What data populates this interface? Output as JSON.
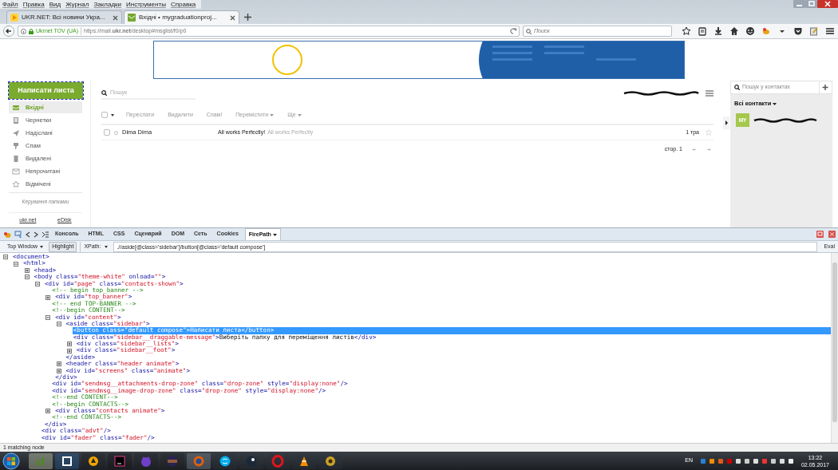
{
  "browser": {
    "menu": [
      "Файл",
      "Правка",
      "Вид",
      "Журнал",
      "Закладки",
      "Инструменты",
      "Справка"
    ],
    "tabs": [
      {
        "label": "UKR.NET: Всі новини Укра...",
        "selected": false
      },
      {
        "label": "Вхідні • mygraduationproj...",
        "selected": true
      }
    ],
    "identity": "Ukrnet TOV (UA)",
    "url": "https://mail.**ukr.net**/desktop#msglist/f0/p0",
    "search": {
      "placeholder": "Поиск"
    }
  },
  "mail": {
    "compose": "Написати листа",
    "folders": [
      {
        "kind": "inbox",
        "label": "Вхідні",
        "selected": true
      },
      {
        "kind": "drafts",
        "label": "Чернетки",
        "selected": false
      },
      {
        "kind": "sent",
        "label": "Надіслані",
        "selected": false
      },
      {
        "kind": "spam",
        "label": "Спам",
        "selected": false
      },
      {
        "kind": "trash",
        "label": "Видалені",
        "selected": false
      },
      {
        "kind": "unread",
        "label": "Непрочитані",
        "selected": false
      },
      {
        "kind": "starred",
        "label": "Відмічені",
        "selected": false
      }
    ],
    "manage_folders": "Керування папками",
    "footer_links": [
      "ukr.net",
      "eDisk"
    ],
    "search": {
      "placeholder": "Пошук"
    },
    "actions": [
      {
        "label": "Переслати",
        "menu": false
      },
      {
        "label": "Видалити",
        "menu": false
      },
      {
        "label": "Спам!",
        "menu": false
      },
      {
        "label": "Перемістити",
        "menu": true
      },
      {
        "label": "Ще",
        "menu": true
      }
    ],
    "messages": [
      {
        "sender": "Dima Dima",
        "subject": "All works Perfectly!",
        "preview": "All works Perfectly",
        "date": "1 тра",
        "checked": false,
        "starred": false
      }
    ],
    "page": "стор. 1",
    "contacts": {
      "search": {
        "placeholder": "Пошук у контактах"
      },
      "filter": "Всі контакти",
      "items": [
        {
          "initials": "MY"
        }
      ]
    }
  },
  "devtools": {
    "tabs": [
      {
        "label": "Консоль",
        "selected": false,
        "menu": false
      },
      {
        "label": "HTML",
        "selected": false,
        "menu": false
      },
      {
        "label": "CSS",
        "selected": false,
        "menu": false
      },
      {
        "label": "Сценарий",
        "selected": false,
        "menu": false
      },
      {
        "label": "DOM",
        "selected": false,
        "menu": false
      },
      {
        "label": "Сеть",
        "selected": false,
        "menu": false
      },
      {
        "label": "Cookies",
        "selected": false,
        "menu": false
      },
      {
        "label": "FirePath",
        "selected": true,
        "menu": true
      }
    ],
    "frame": "Top Window",
    "highlight": "Highlight",
    "xpath_label": "XPath:",
    "xpath": ".//aside[@class='sidebar']/button[@class='default compose']",
    "eval": "Eval",
    "tree": [
      {
        "kind": "element",
        "text": "<document>",
        "expanded": true,
        "selected": false,
        "children": [
          {
            "kind": "element",
            "text": "<html>",
            "expanded": true,
            "selected": false,
            "children": [
              {
                "kind": "element",
                "text": "<head>",
                "expanded": false,
                "selected": false
              },
              {
                "kind": "element",
                "text": "<body class=\"theme-white\" onload=\"\">",
                "expanded": true,
                "selected": false,
                "children": [
                  {
                    "kind": "element",
                    "text": "<div id=\"page\" class=\"contacts-shown\">",
                    "expanded": true,
                    "selected": false,
                    "closing": "</div>",
                    "children": [
                      {
                        "kind": "comment",
                        "text": "<!-- begin top_banner -->",
                        "selected": false
                      },
                      {
                        "kind": "element",
                        "text": "<div id=\"top_banner\">",
                        "expanded": false,
                        "selected": false
                      },
                      {
                        "kind": "comment",
                        "text": "<!-- end TOP-BANNER -->",
                        "selected": false
                      },
                      {
                        "kind": "comment",
                        "text": "<!--begin CONTENT-->",
                        "selected": false
                      },
                      {
                        "kind": "element",
                        "text": "<div id=\"content\">",
                        "expanded": true,
                        "selected": false,
                        "closing": "</div>",
                        "children": [
                          {
                            "kind": "element",
                            "text": "<aside class=\"sidebar\">",
                            "expanded": true,
                            "selected": false,
                            "closing": "</aside>",
                            "children": [
                              {
                                "kind": "element",
                                "text": "<button class=\"default compose\">Написати листа</button>",
                                "selected": true
                              },
                              {
                                "kind": "element",
                                "text": "<div class=\"sidebar__draggable-message\">Виберіть папку для переміщення листів</div>",
                                "selected": false
                              },
                              {
                                "kind": "element",
                                "text": "<div class=\"sidebar__lists\">",
                                "expanded": false,
                                "selected": false
                              },
                              {
                                "kind": "element",
                                "text": "<div class=\"sidebar__foot\">",
                                "expanded": false,
                                "selected": false
                              }
                            ]
                          },
                          {
                            "kind": "element",
                            "text": "<header class=\"header animate\">",
                            "expanded": false,
                            "selected": false
                          },
                          {
                            "kind": "element",
                            "text": "<div id=\"screens\" class=\"animate\">",
                            "expanded": false,
                            "selected": false
                          }
                        ]
                      },
                      {
                        "kind": "element",
                        "text": "<div id=\"sendmsg__attachments-drop-zone\" class=\"drop-zone\" style=\"display:none\"/>",
                        "selected": false
                      },
                      {
                        "kind": "element",
                        "text": "<div id=\"sendmsg__image-drop-zone\" class=\"drop-zone\" style=\"display:none\"/>",
                        "selected": false
                      },
                      {
                        "kind": "comment",
                        "text": "<!--end CONTENT-->",
                        "selected": false
                      },
                      {
                        "kind": "comment",
                        "text": "<!--begin CONTACTS-->",
                        "selected": false
                      },
                      {
                        "kind": "element",
                        "text": "<div class=\"contacts animate\">",
                        "expanded": false,
                        "selected": false
                      },
                      {
                        "kind": "comment",
                        "text": "<!--end CONTACTS-->",
                        "selected": false
                      }
                    ]
                  },
                  {
                    "kind": "element",
                    "text": "<div class=\"advt\"/>",
                    "selected": false
                  },
                  {
                    "kind": "element",
                    "text": "<div id=\"fader\" class=\"fader\"/>",
                    "selected": false
                  }
                ]
              }
            ]
          }
        ]
      }
    ]
  },
  "status_bar": "1 matching node",
  "taskbar": {
    "language": "EN",
    "time": "13:22",
    "date": "02.05.2017"
  }
}
